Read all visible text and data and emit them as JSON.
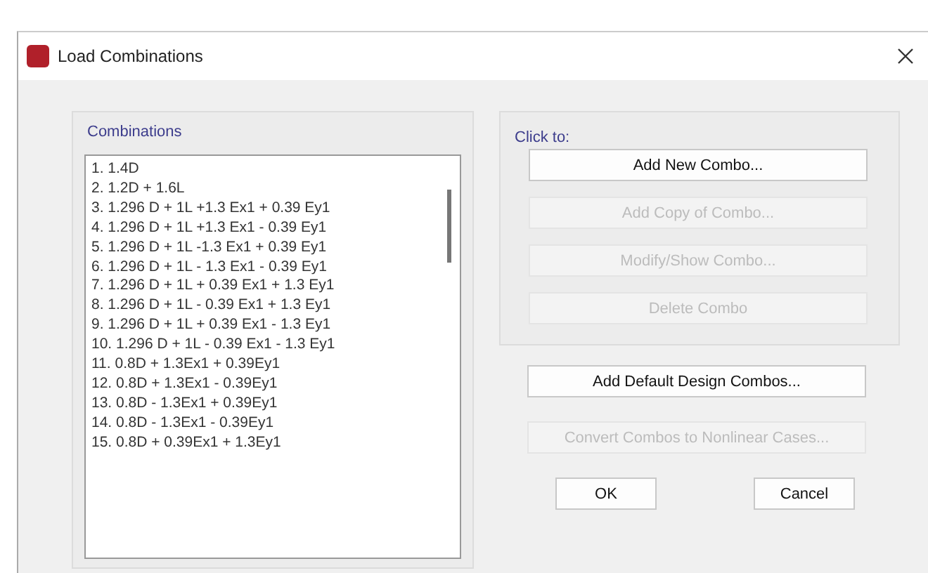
{
  "window": {
    "title": "Load Combinations"
  },
  "combinations": {
    "label": "Combinations",
    "items": [
      {
        "text": "1. 1.4D",
        "selected": false
      },
      {
        "text": "2. 1.2D + 1.6L",
        "selected": false
      },
      {
        "text": "3. 1.296 D + 1L +1.3 Ex1 + 0.39 Ey1",
        "selected": false
      },
      {
        "text": "4. 1.296 D + 1L +1.3 Ex1 - 0.39 Ey1",
        "selected": false
      },
      {
        "text": "5. 1.296 D + 1L -1.3 Ex1 + 0.39 Ey1",
        "selected": false
      },
      {
        "text": "6. 1.296 D + 1L - 1.3 Ex1 - 0.39 Ey1",
        "selected": false
      },
      {
        "text": "7. 1.296 D + 1L + 0.39 Ex1 + 1.3 Ey1",
        "selected": false
      },
      {
        "text": "8. 1.296 D + 1L - 0.39 Ex1 + 1.3 Ey1",
        "selected": false
      },
      {
        "text": "9. 1.296 D + 1L + 0.39 Ex1 - 1.3 Ey1",
        "selected": false
      },
      {
        "text": "10. 1.296 D + 1L - 0.39 Ex1 - 1.3 Ey1",
        "selected": false
      },
      {
        "text": "11. 0.8D + 1.3Ex1 + 0.39Ey1",
        "selected": false
      },
      {
        "text": "12. 0.8D + 1.3Ex1 - 0.39Ey1",
        "selected": false
      },
      {
        "text": "13. 0.8D - 1.3Ex1 + 0.39Ey1",
        "selected": false
      },
      {
        "text": "14. 0.8D - 1.3Ex1 - 0.39Ey1",
        "selected": false
      },
      {
        "text": "15. 0.8D + 0.39Ex1 + 1.3Ey1",
        "selected": false
      }
    ]
  },
  "click_to": {
    "label": "Click to:",
    "buttons": [
      {
        "label": "Add New Combo...",
        "disabled": false
      },
      {
        "label": "Add Copy of Combo...",
        "disabled": true
      },
      {
        "label": "Modify/Show Combo...",
        "disabled": true
      },
      {
        "label": "Delete Combo",
        "disabled": true
      }
    ]
  },
  "actions": [
    {
      "label": "Add Default Design Combos...",
      "disabled": false
    },
    {
      "label": "Convert Combos to Nonlinear Cases...",
      "disabled": true
    }
  ],
  "dialog_buttons": [
    {
      "label": "OK",
      "disabled": false
    },
    {
      "label": "Cancel",
      "disabled": false
    }
  ]
}
